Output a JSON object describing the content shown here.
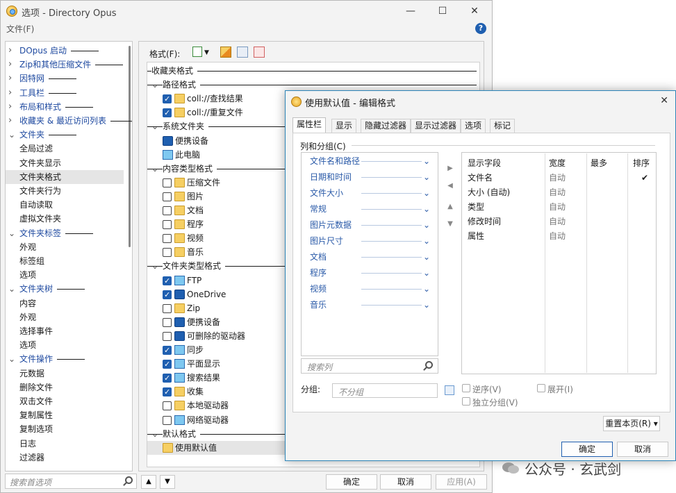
{
  "main": {
    "title": "选项 - Directory Opus",
    "menu_file": "文件(F)",
    "help": "?",
    "tree_search_placeholder": "搜索首选项",
    "buttons": {
      "ok": "确定",
      "cancel": "取消",
      "apply": "应用(A)"
    },
    "tree": [
      {
        "label": "DOpus 启动",
        "type": "header",
        "expanded": false
      },
      {
        "label": "Zip和其他压缩文件",
        "type": "header",
        "expanded": false
      },
      {
        "label": "因特网",
        "type": "header",
        "expanded": false
      },
      {
        "label": "工具栏",
        "type": "header",
        "expanded": false
      },
      {
        "label": "布局和样式",
        "type": "header",
        "expanded": false
      },
      {
        "label": "收藏夹 & 最近访问列表",
        "type": "header",
        "expanded": false
      },
      {
        "label": "文件夹",
        "type": "header",
        "expanded": true
      },
      {
        "label": "全局过滤",
        "type": "item"
      },
      {
        "label": "文件夹显示",
        "type": "item"
      },
      {
        "label": "文件夹格式",
        "type": "item",
        "selected": true
      },
      {
        "label": "文件夹行为",
        "type": "item"
      },
      {
        "label": "自动读取",
        "type": "item"
      },
      {
        "label": "虚拟文件夹",
        "type": "item"
      },
      {
        "label": "文件夹标签",
        "type": "header",
        "expanded": true
      },
      {
        "label": "外观",
        "type": "item"
      },
      {
        "label": "标签组",
        "type": "item"
      },
      {
        "label": "选项",
        "type": "item"
      },
      {
        "label": "文件夹树",
        "type": "header",
        "expanded": true
      },
      {
        "label": "内容",
        "type": "item"
      },
      {
        "label": "外观",
        "type": "item"
      },
      {
        "label": "选择事件",
        "type": "item"
      },
      {
        "label": "选项",
        "type": "item"
      },
      {
        "label": "文件操作",
        "type": "header",
        "expanded": true
      },
      {
        "label": "元数据",
        "type": "item"
      },
      {
        "label": "删除文件",
        "type": "item"
      },
      {
        "label": "双击文件",
        "type": "item"
      },
      {
        "label": "复制属性",
        "type": "item"
      },
      {
        "label": "复制选项",
        "type": "item"
      },
      {
        "label": "日志",
        "type": "item"
      },
      {
        "label": "过滤器",
        "type": "item"
      }
    ],
    "format_label": "格式(F):",
    "formats": [
      {
        "label": "收藏夹格式",
        "type": "header",
        "chevron": false
      },
      {
        "label": "路径格式",
        "type": "header",
        "chevron": true
      },
      {
        "label": "coll://查找结果",
        "type": "item",
        "checked": true,
        "icon": "folder"
      },
      {
        "label": "coll://重复文件",
        "type": "item",
        "checked": true,
        "icon": "folder"
      },
      {
        "label": "系统文件夹",
        "type": "header",
        "chevron": true
      },
      {
        "label": "便携设备",
        "type": "item",
        "checked": null,
        "icon": "device"
      },
      {
        "label": "此电脑",
        "type": "item",
        "checked": null,
        "icon": "pc"
      },
      {
        "label": "内容类型格式",
        "type": "header",
        "chevron": true
      },
      {
        "label": "压缩文件",
        "type": "item",
        "checked": false,
        "icon": "folder"
      },
      {
        "label": "图片",
        "type": "item",
        "checked": false,
        "icon": "folder"
      },
      {
        "label": "文档",
        "type": "item",
        "checked": false,
        "icon": "folder"
      },
      {
        "label": "程序",
        "type": "item",
        "checked": false,
        "icon": "folder"
      },
      {
        "label": "视频",
        "type": "item",
        "checked": false,
        "icon": "folder"
      },
      {
        "label": "音乐",
        "type": "item",
        "checked": false,
        "icon": "folder"
      },
      {
        "label": "文件夹类型格式",
        "type": "header",
        "chevron": true
      },
      {
        "label": "FTP",
        "type": "item",
        "checked": true,
        "icon": "pc"
      },
      {
        "label": "OneDrive",
        "type": "item",
        "checked": true,
        "icon": "device"
      },
      {
        "label": "Zip",
        "type": "item",
        "checked": false,
        "icon": "folder"
      },
      {
        "label": "便携设备",
        "type": "item",
        "checked": false,
        "icon": "device"
      },
      {
        "label": "可删除的驱动器",
        "type": "item",
        "checked": false,
        "icon": "device"
      },
      {
        "label": "同步",
        "type": "item",
        "checked": true,
        "icon": "pc"
      },
      {
        "label": "平面显示",
        "type": "item",
        "checked": true,
        "icon": "pc"
      },
      {
        "label": "搜索结果",
        "type": "item",
        "checked": true,
        "icon": "pc"
      },
      {
        "label": "收集",
        "type": "item",
        "checked": true,
        "icon": "folder"
      },
      {
        "label": "本地驱动器",
        "type": "item",
        "checked": false,
        "icon": "folder"
      },
      {
        "label": "网络驱动器",
        "type": "item",
        "checked": false,
        "icon": "pc"
      },
      {
        "label": "默认格式",
        "type": "header",
        "chevron": true
      },
      {
        "label": "使用默认值",
        "type": "item",
        "checked": null,
        "icon": "folder",
        "selected": true
      }
    ]
  },
  "dialog": {
    "title": "使用默认值 - 编辑格式",
    "tabs": [
      "属性栏",
      "显示",
      "隐藏过滤器",
      "显示过滤器",
      "选项",
      "标记"
    ],
    "group_label": "列和分组(C)",
    "columns": [
      "文件名和路径",
      "日期和时间",
      "文件大小",
      "常规",
      "图片元数据",
      "图片尺寸",
      "文档",
      "程序",
      "视频",
      "音乐"
    ],
    "column_search_placeholder": "搜索列",
    "table_headers": [
      "显示字段",
      "宽度",
      "最多",
      "排序"
    ],
    "rows": [
      {
        "field": "文件名",
        "width": "自动",
        "sort": "✔"
      },
      {
        "field": "大小 (自动)",
        "width": "自动",
        "sort": ""
      },
      {
        "field": "类型",
        "width": "自动",
        "sort": ""
      },
      {
        "field": "修改时间",
        "width": "自动",
        "sort": ""
      },
      {
        "field": "属性",
        "width": "自动",
        "sort": ""
      }
    ],
    "group_by_label": "分组:",
    "group_by_placeholder": "不分组",
    "reverse_label": "逆序(V)",
    "expand_label": "展开(I)",
    "independent_label": "独立分组(V)",
    "reset_label": "重置本页(R) ▾",
    "ok": "确定",
    "cancel": "取消"
  },
  "watermark": "公众号 · 玄武剑"
}
